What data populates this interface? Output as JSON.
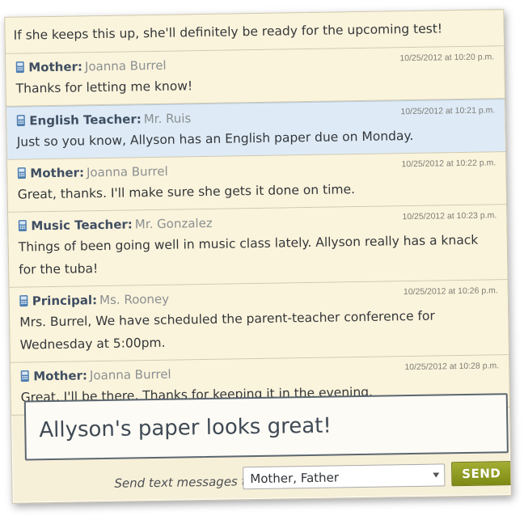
{
  "thread": {
    "messages": [
      {
        "role": "",
        "name": "",
        "time": "",
        "text": "If she keeps this up, she'll definitely be ready for the upcoming test!"
      },
      {
        "role": "Mother:",
        "name": "Joanna Burrel",
        "time": "10/25/2012 at 10:20 p.m.",
        "text": "Thanks for letting me know!"
      },
      {
        "role": "English Teacher:",
        "name": "Mr. Ruis",
        "time": "10/25/2012 at 10:21 p.m.",
        "text": "Just so you know, Allyson has an English paper due on Monday."
      },
      {
        "role": "Mother:",
        "name": "Joanna Burrel",
        "time": "10/25/2012 at 10:22 p.m.",
        "text": "Great, thanks. I'll make sure she gets it done on time."
      },
      {
        "role": "Music Teacher:",
        "name": "Mr. Gonzalez",
        "time": "10/25/2012 at 10:23 p.m.",
        "text": "Things of been going well in music class lately. Allyson really has a knack for the tuba!"
      },
      {
        "role": "Principal:",
        "name": "Ms. Rooney",
        "time": "10/25/2012 at 10:26 p.m.",
        "text": "Mrs. Burrel, We have scheduled the parent-teacher conference for Wednesday at 5:00pm."
      },
      {
        "role": "Mother:",
        "name": "Joanna Burrel",
        "time": "10/25/2012 at 10:28 p.m.",
        "text": "Great, I'll be there. Thanks for keeping it in the evening."
      }
    ]
  },
  "compose": {
    "text": "Allyson's paper looks great!"
  },
  "send": {
    "label": "Send text messages to",
    "recipients": "Mother, Father",
    "button": "SEND"
  },
  "colors": {
    "accent": "#8a9620",
    "highlight": "#deebf6",
    "background": "#f7f0d8"
  },
  "icons": {
    "sender": "mobile-phone-icon"
  }
}
